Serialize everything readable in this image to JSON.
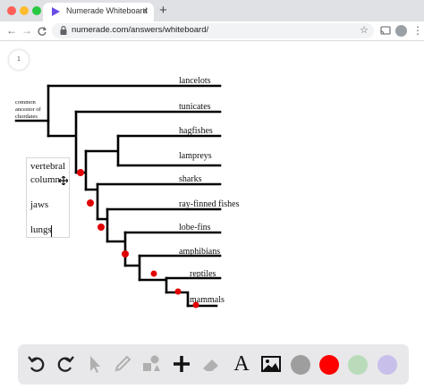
{
  "browser": {
    "tab_title": "Numerade Whiteboard",
    "close_symbol": "×",
    "new_tab_symbol": "+",
    "url": "numerade.com/answers/whiteboard/",
    "back_glyph": "←",
    "forward_glyph": "→",
    "reload_glyph": "C",
    "star_glyph": "☆",
    "menu_glyph": "⋮"
  },
  "whiteboard": {
    "page_number": "1",
    "common_ancestor_lines": [
      "common",
      "ancestor of",
      "chordates"
    ],
    "taxa": [
      "lancelots",
      "tunicates",
      "hagfishes",
      "lampreys",
      "sharks",
      "ray-finned fishes",
      "lobe-fins",
      "amphibians",
      "reptiles",
      "mammals"
    ],
    "traits": [
      "vertebral",
      "column",
      "jaws",
      "lungs"
    ],
    "marker_color": "#ff0000"
  },
  "tools": [
    {
      "name": "undo-icon",
      "label": "undo"
    },
    {
      "name": "redo-icon",
      "label": "redo"
    },
    {
      "name": "select-pointer-icon",
      "label": "select"
    },
    {
      "name": "pen-icon",
      "label": "pen"
    },
    {
      "name": "shapes-icon",
      "label": "shapes"
    },
    {
      "name": "add-icon",
      "label": "add"
    },
    {
      "name": "eraser-icon",
      "label": "eraser"
    },
    {
      "name": "text-icon",
      "label": "A"
    },
    {
      "name": "image-icon",
      "label": "image"
    }
  ],
  "colors": {
    "swatches": [
      "#9e9e9e",
      "#ff0000",
      "#b9dbb9",
      "#c8c0ea"
    ],
    "accent": "#6b4de6"
  }
}
